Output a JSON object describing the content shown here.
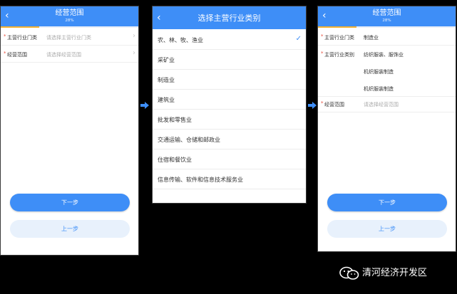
{
  "screen1": {
    "title": "经营范围",
    "progress": "28%",
    "progress_value": 0.28,
    "back_icon": "chevron-left-icon",
    "rows": [
      {
        "label": "主营行业门类",
        "placeholder": "请选择主营行业门类",
        "required": true
      },
      {
        "label": "经营范围",
        "placeholder": "请选择经营范围",
        "required": true
      }
    ],
    "next_label": "下一步",
    "prev_label": "上一步"
  },
  "screen2": {
    "title": "选择主营行业类别",
    "selected_index": 0,
    "categories": [
      "农、林、牧、渔业",
      "采矿业",
      "制造业",
      "建筑业",
      "批发和零售业",
      "交通运输、仓储和邮政业",
      "住宿和餐饮业",
      "信息传输、软件和信息技术服务业"
    ]
  },
  "screen3": {
    "title": "经营范围",
    "progress": "28%",
    "progress_value": 0.28,
    "industry_door_label": "主营行业门类",
    "industry_door_value": "制造业",
    "industry_category_label": "主营行业类别",
    "industry_category_values": [
      "纺织服装、服饰业",
      "机织服装制造",
      "机织服装制造"
    ],
    "scope_label": "经营范围",
    "scope_placeholder": "请选择经营范围",
    "next_label": "下一步",
    "prev_label": "上一步"
  },
  "flow_arrow_icon": "arrow-right-icon",
  "watermark": {
    "logo_icon": "wechat-icon",
    "text": "清河经济开发区"
  },
  "colors": {
    "header": "#3e8ef7",
    "progress": "#f2b233",
    "required_star": "#e74c3c",
    "button_secondary": "#e8f1fc",
    "background": "#000000"
  }
}
